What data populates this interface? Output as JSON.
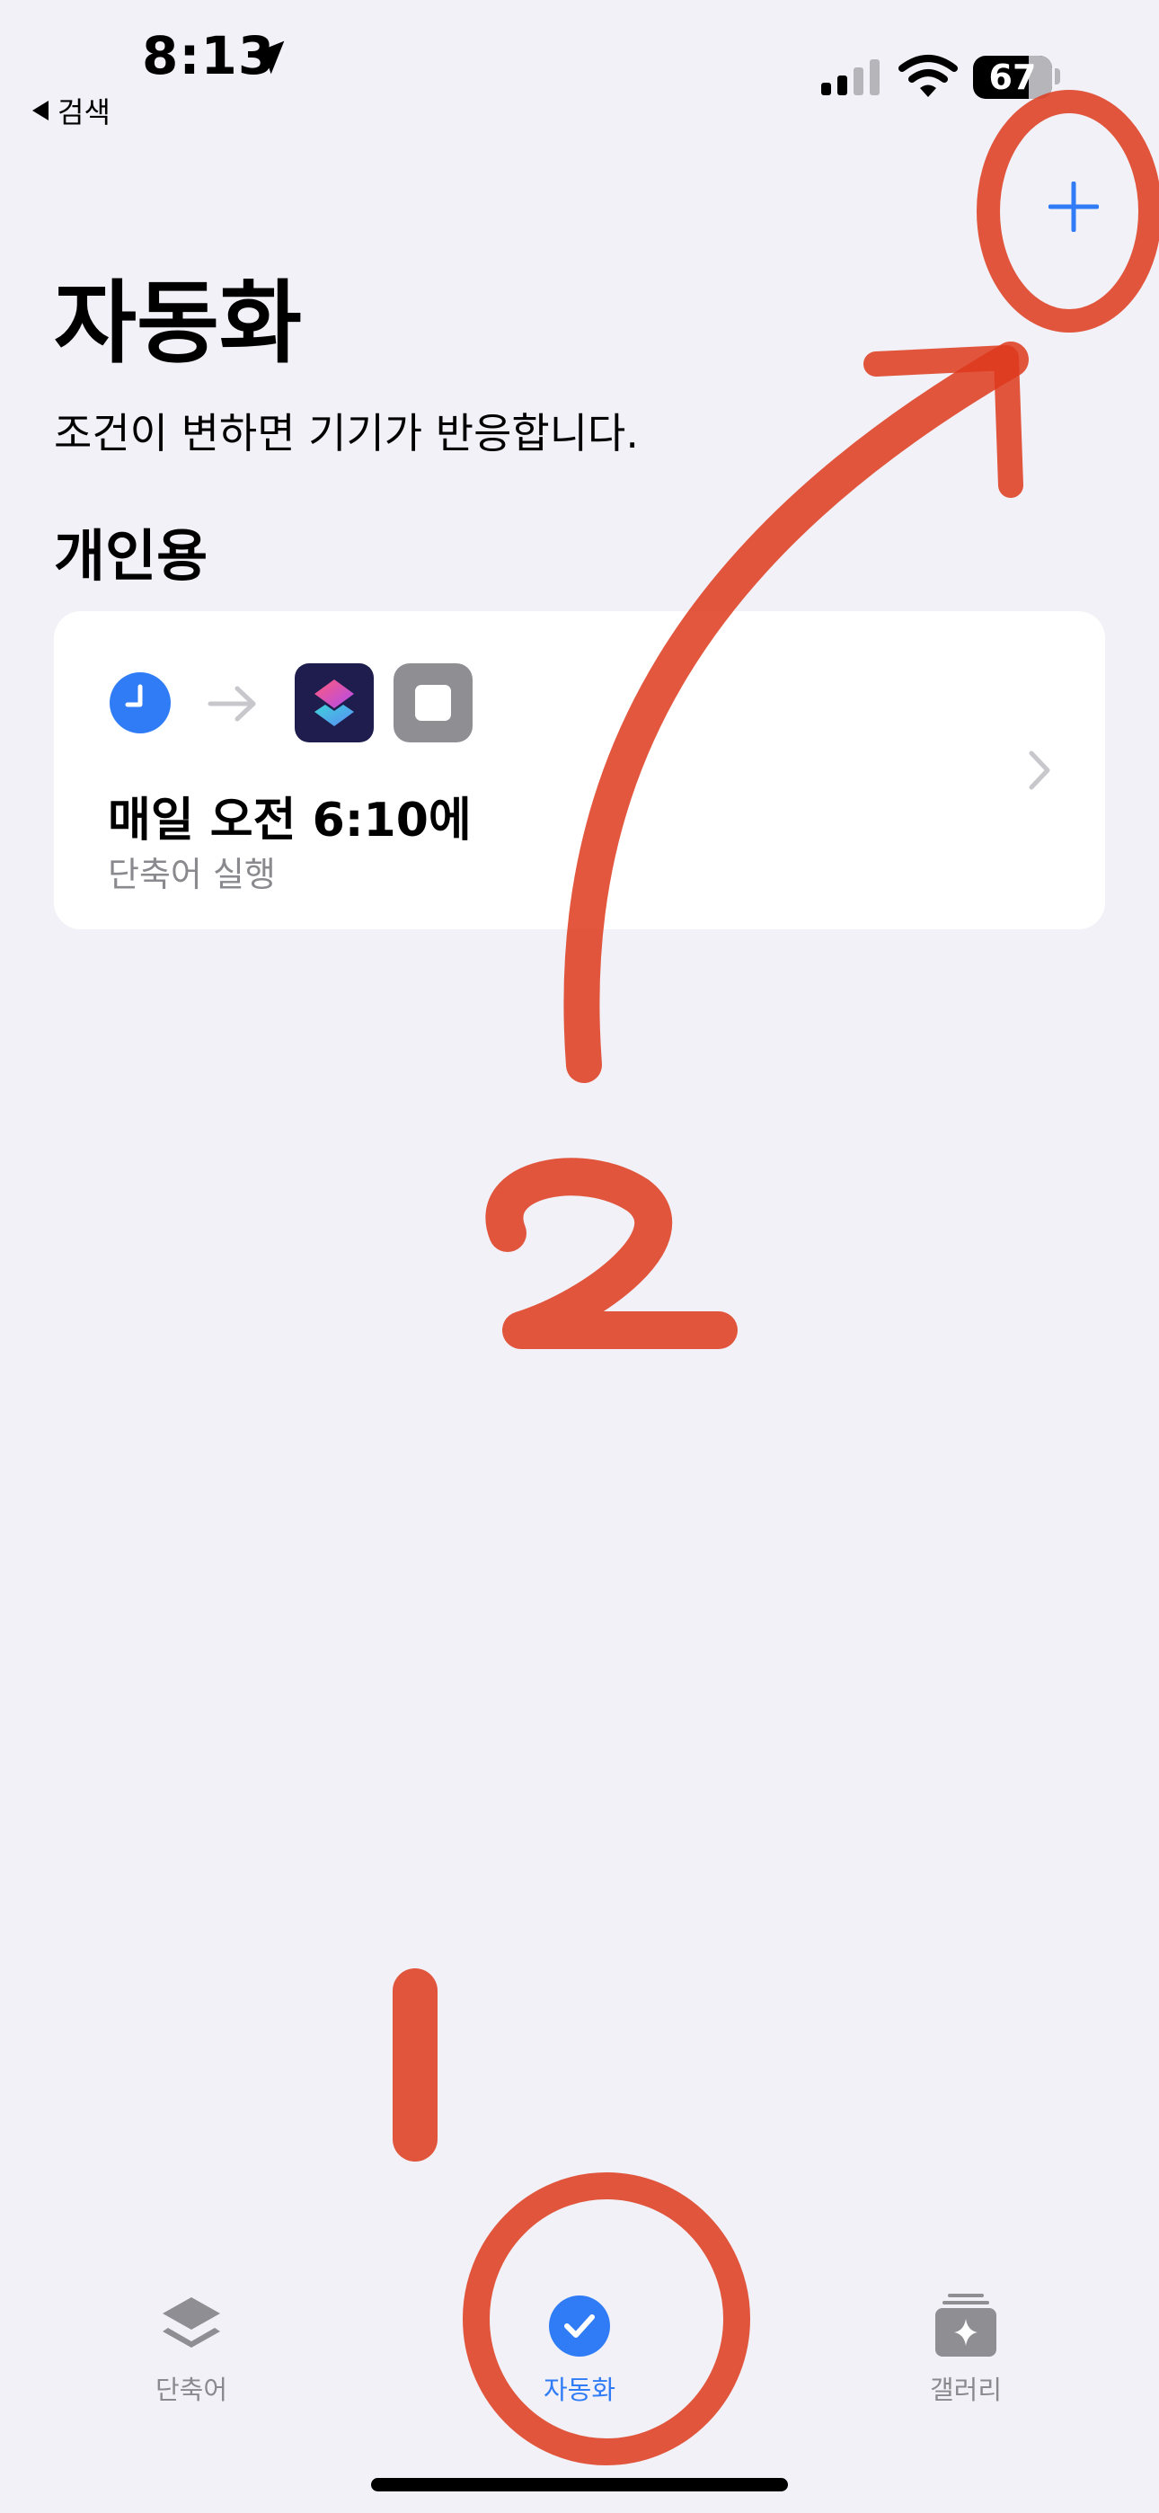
{
  "status_bar": {
    "time": "8:13",
    "back_label": "검색",
    "battery": "67"
  },
  "header": {
    "title": "자동화",
    "subtitle": "조건이 변하면 기기가 반응합니다."
  },
  "section": {
    "title": "개인용"
  },
  "automations": [
    {
      "title": "매일 오전 6:10에",
      "subtitle": "단축어 실행"
    }
  ],
  "tabs": [
    {
      "label": "단축어",
      "active": false
    },
    {
      "label": "자동화",
      "active": true
    },
    {
      "label": "갤러리",
      "active": false
    }
  ],
  "annotations": {
    "marker_1": "1",
    "marker_2": "2"
  },
  "colors": {
    "background": "#f2f1f7",
    "accent": "#2f7cf6",
    "annotation": "#de3a1c",
    "inactive": "#8a8a8e"
  }
}
